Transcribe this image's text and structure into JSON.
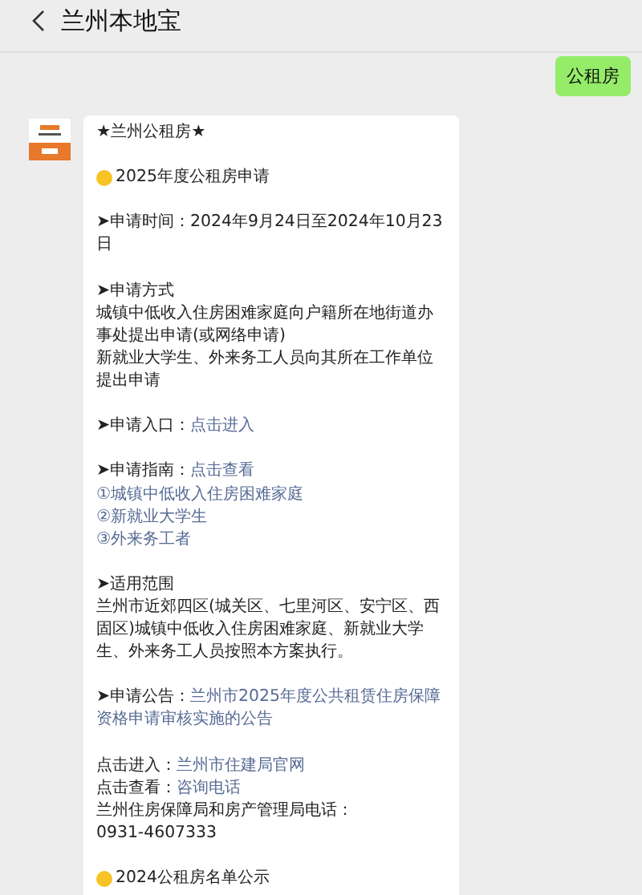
{
  "header": {
    "title": "兰州本地宝"
  },
  "sent_message": {
    "text": "公租房"
  },
  "reply": {
    "blocks": [
      [
        {
          "kind": "text",
          "segments": [
            {
              "text": "★兰州公租房★",
              "link": false
            }
          ]
        }
      ],
      [
        {
          "kind": "dot",
          "segments": [
            {
              "text": "2025年度公租房申请",
              "link": false
            }
          ]
        }
      ],
      [
        {
          "kind": "text",
          "segments": [
            {
              "text": "➤申请时间：2024年9月24日至2024年10月23日",
              "link": false
            }
          ]
        }
      ],
      [
        {
          "kind": "text",
          "segments": [
            {
              "text": "➤申请方式",
              "link": false
            }
          ]
        },
        {
          "kind": "text",
          "segments": [
            {
              "text": "城镇中低收入住房困难家庭向户籍所在地街道办事处提出申请(或网络申请)",
              "link": false
            }
          ]
        },
        {
          "kind": "text",
          "segments": [
            {
              "text": "新就业大学生、外来务工人员向其所在工作单位提出申请",
              "link": false
            }
          ]
        }
      ],
      [
        {
          "kind": "text",
          "segments": [
            {
              "text": "➤申请入口：",
              "link": false
            },
            {
              "text": "点击进入",
              "link": true
            }
          ]
        }
      ],
      [
        {
          "kind": "text",
          "segments": [
            {
              "text": "➤申请指南：",
              "link": false
            },
            {
              "text": "点击查看",
              "link": true
            }
          ]
        },
        {
          "kind": "text",
          "segments": [
            {
              "text": "①城镇中低收入住房困难家庭",
              "link": true
            }
          ]
        },
        {
          "kind": "text",
          "segments": [
            {
              "text": "②新就业大学生",
              "link": true
            }
          ]
        },
        {
          "kind": "text",
          "segments": [
            {
              "text": "③外来务工者",
              "link": true
            }
          ]
        }
      ],
      [
        {
          "kind": "text",
          "segments": [
            {
              "text": "➤适用范围",
              "link": false
            }
          ]
        },
        {
          "kind": "text",
          "segments": [
            {
              "text": "兰州市近郊四区(城关区、七里河区、安宁区、西固区)城镇中低收入住房困难家庭、新就业大学生、外来务工人员按照本方案执行。",
              "link": false
            }
          ]
        }
      ],
      [
        {
          "kind": "text",
          "segments": [
            {
              "text": "➤申请公告：",
              "link": false
            },
            {
              "text": "兰州市2025年度公共租赁住房保障",
              "link": true
            }
          ]
        },
        {
          "kind": "text",
          "segments": [
            {
              "text": "资格申请审核实施的公告",
              "link": true
            }
          ]
        }
      ],
      [
        {
          "kind": "text",
          "segments": [
            {
              "text": "点击进入：",
              "link": false
            },
            {
              "text": "兰州市住建局官网",
              "link": true
            }
          ]
        },
        {
          "kind": "text",
          "segments": [
            {
              "text": "点击查看：",
              "link": false
            },
            {
              "text": "咨询电话",
              "link": true
            }
          ]
        },
        {
          "kind": "text",
          "segments": [
            {
              "text": "兰州住房保障局和房产管理局电话：",
              "link": false
            }
          ]
        },
        {
          "kind": "text",
          "segments": [
            {
              "text": "0931-4607333",
              "link": false
            }
          ]
        }
      ],
      [
        {
          "kind": "dot",
          "segments": [
            {
              "text": "2024公租房名单公示",
              "link": false
            }
          ]
        }
      ]
    ]
  }
}
